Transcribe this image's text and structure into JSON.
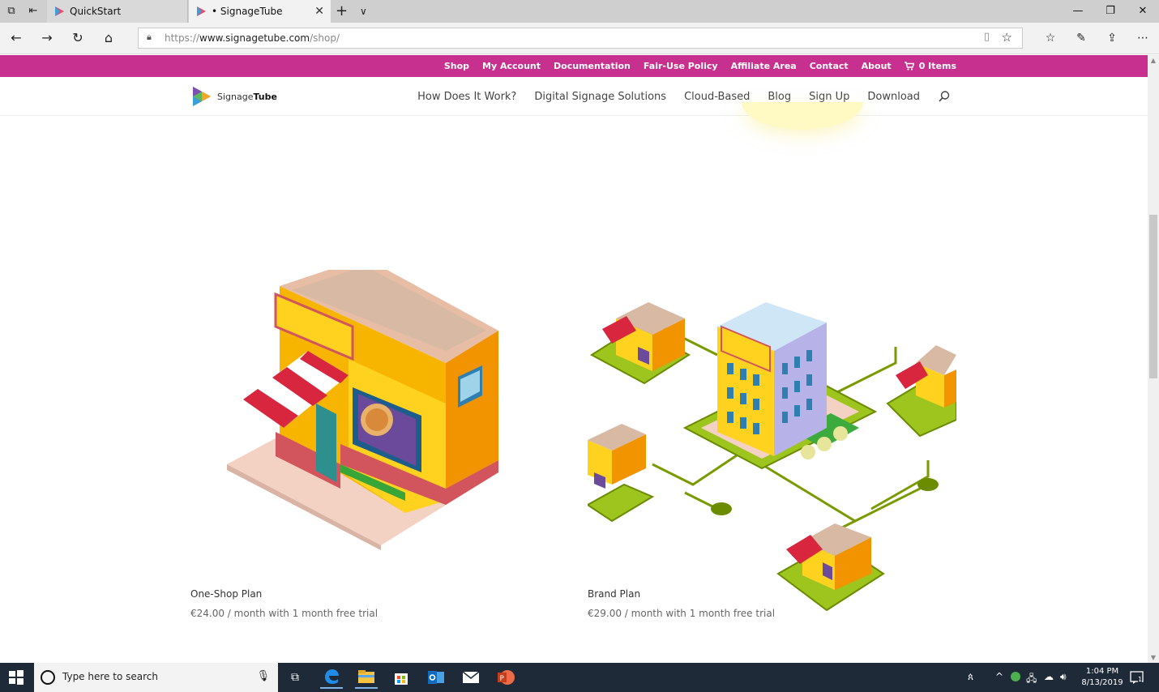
{
  "browser": {
    "tabs": [
      {
        "title": "QuickStart",
        "active": false
      },
      {
        "title": "• SignageTube",
        "active": true
      }
    ],
    "address": {
      "prefix": "https://",
      "domain": "www.signagetube.com",
      "path": "/shop/"
    }
  },
  "site": {
    "top_links": [
      "Shop",
      "My Account",
      "Documentation",
      "Fair-Use Policy",
      "Affiliate Area",
      "Contact",
      "About"
    ],
    "cart_label": "0 Items",
    "logo": {
      "part1": "Signage",
      "part2": "Tube"
    },
    "nav_links": [
      "How Does It Work?",
      "Digital Signage Solutions",
      "Cloud-Based",
      "Blog",
      "Sign Up",
      "Download"
    ],
    "accent_color": "#c7308f"
  },
  "products": [
    {
      "name": "One-Shop Plan",
      "price": "€24.00 / month with 1 month free trial"
    },
    {
      "name": "Brand Plan",
      "price": "€29.00 / month with 1 month free trial"
    }
  ],
  "taskbar": {
    "search_placeholder": "Type here to search",
    "time": "1:04 PM",
    "date": "8/13/2019",
    "notification_count": "1"
  }
}
